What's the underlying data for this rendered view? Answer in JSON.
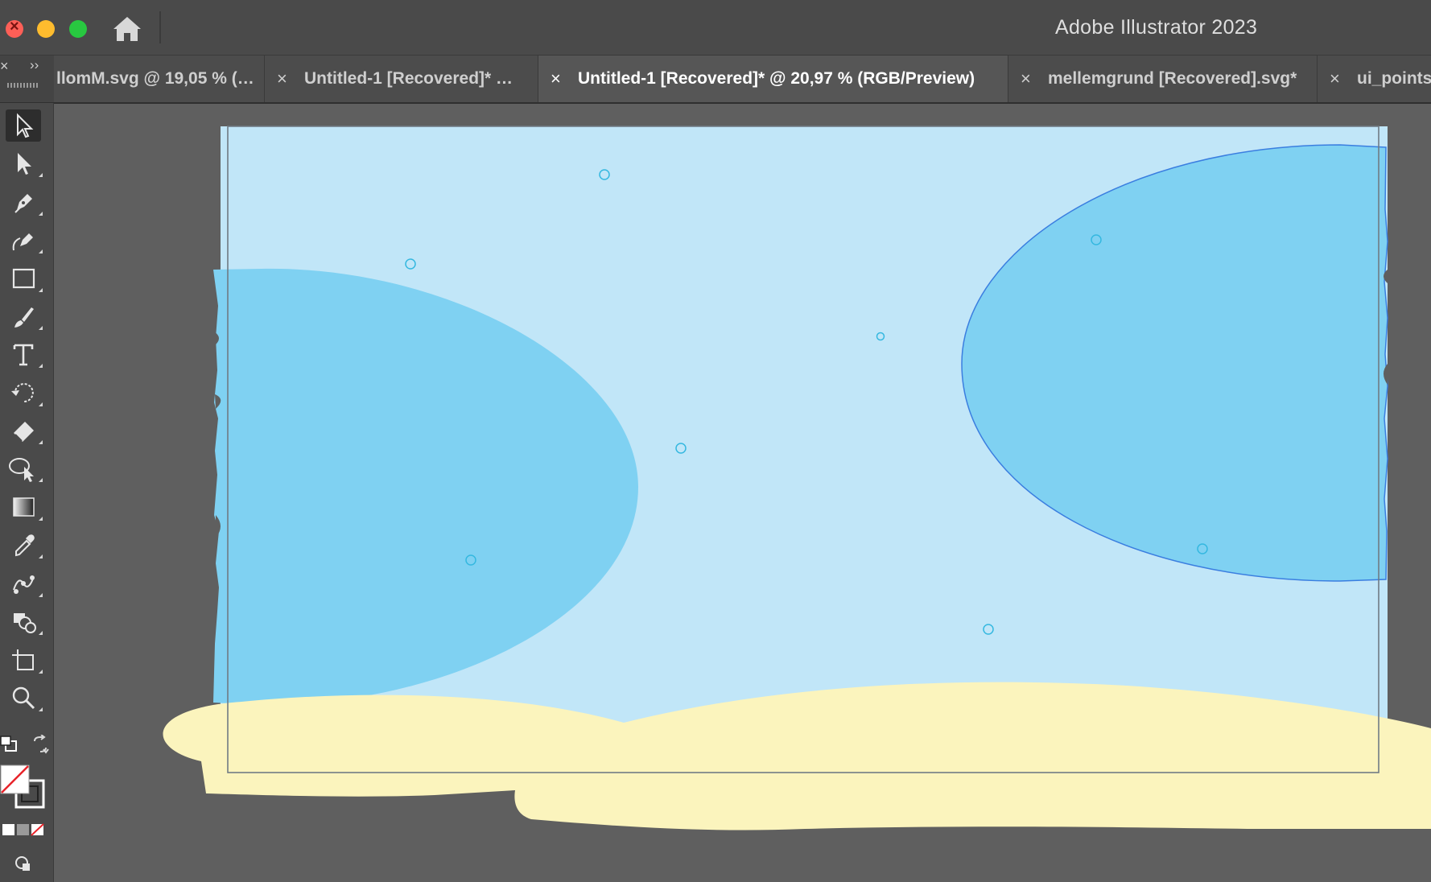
{
  "window": {
    "app_title": "Adobe Illustrator 2023"
  },
  "tabs": [
    {
      "label": "llomM.svg @ 19,05 % (…",
      "active": false
    },
    {
      "label": "Untitled-1 [Recovered]* …",
      "active": false
    },
    {
      "label": "Untitled-1 [Recovered]* @ 20,97 % (RGB/Preview)",
      "active": true
    },
    {
      "label": "mellemgrund [Recovered].svg*",
      "active": false
    },
    {
      "label": "ui_points",
      "active": false
    }
  ],
  "tab_close_glyph": "×",
  "panel_controls": {
    "close_glyph": "×",
    "expand_glyph": "››"
  },
  "tools": [
    "selection-tool",
    "direct-selection-tool",
    "pen-tool",
    "curvature-tool",
    "rectangle-tool",
    "paintbrush-tool",
    "type-tool",
    "rotate-tool",
    "eraser-tool",
    "shape-builder-tool",
    "gradient-tool",
    "eyedropper-tool",
    "blend-tool",
    "symbol-sprayer-tool",
    "artboard-tool",
    "zoom-tool"
  ],
  "colors": {
    "artboard_sky": "#c1e6f8",
    "shape_blue": "#7fd1f2",
    "sand": "#fbf4bd",
    "canvas_bg": "#5f5f5f",
    "selection_outline": "#3a7ee0",
    "fill_none_slash": "#e8232a"
  }
}
